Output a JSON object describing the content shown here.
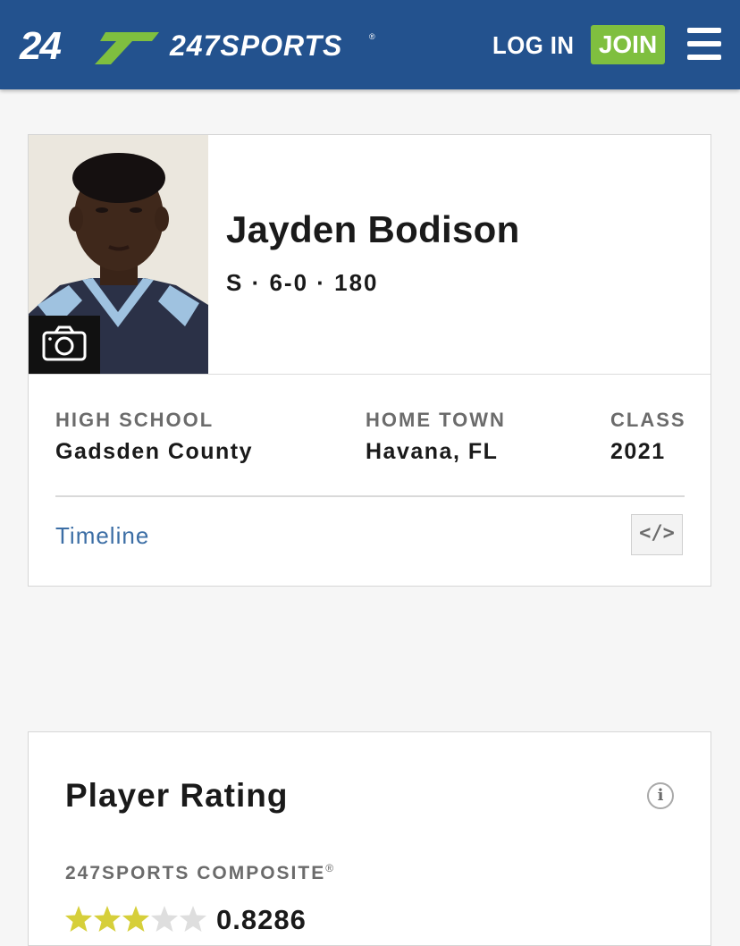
{
  "header": {
    "logo_text": "247SPORTS",
    "login_label": "LOG IN",
    "join_label": "JOIN",
    "menu_icon": "hamburger-menu-icon",
    "background_color": "#23528e",
    "join_color": "#7fbf3f",
    "logo_accent_color": "#7fbf3f"
  },
  "profile": {
    "name": "Jayden Bodison",
    "vitals": "S · 6-0 · 180",
    "photo_icon": "camera-icon",
    "details": [
      {
        "label": "HIGH SCHOOL",
        "value": "Gadsden County"
      },
      {
        "label": "HOME TOWN",
        "value": "Havana, FL"
      },
      {
        "label": "CLASS",
        "value": "2021"
      }
    ],
    "timeline_label": "Timeline",
    "embed_label": "</>",
    "link_color": "#3c6ea5"
  },
  "rating": {
    "title": "Player Rating",
    "info_label": "i",
    "composite_label": "247SPORTS COMPOSITE",
    "composite_mark": "®",
    "stars_filled": 3,
    "stars_total": 5,
    "star_filled_color": "#d6cf3a",
    "star_empty_color": "#dedede",
    "score": "0.8286"
  }
}
